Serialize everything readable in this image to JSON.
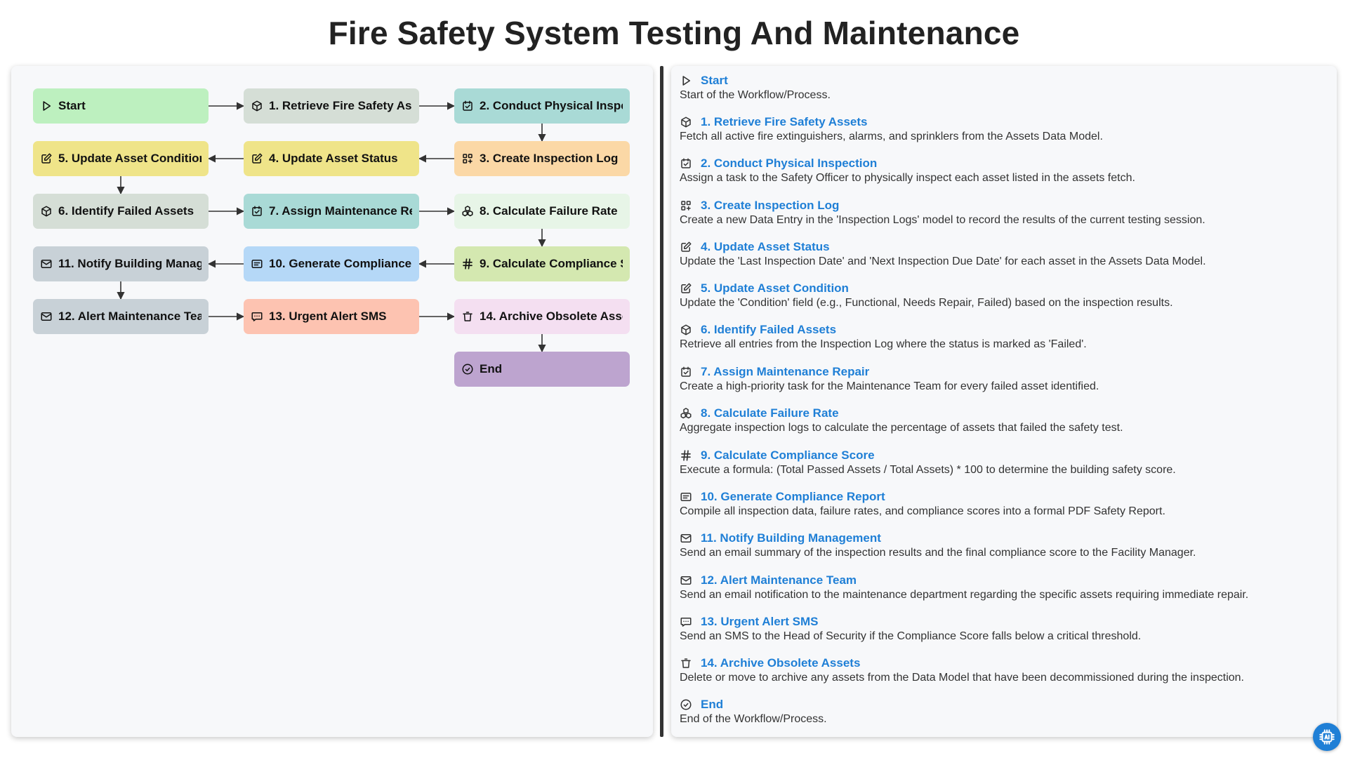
{
  "title": "Fire Safety System Testing And Maintenance",
  "colors": {
    "link": "#1f7fd6",
    "start": "#bdf0bf",
    "step1": "#d5ded6",
    "step2": "#a9dad6",
    "step3": "#fbd8a6",
    "step4": "#efe489",
    "step5": "#efe489",
    "step6": "#d5ded6",
    "step7": "#a9dad6",
    "step8": "#e7f5e7",
    "step9": "#d4e8b0",
    "step10": "#b5d8f7",
    "step11": "#c8d1d7",
    "step12": "#c8d1d7",
    "step13": "#fdc3b1",
    "step14": "#f4dff1",
    "end": "#bda4cf"
  },
  "nodes": [
    {
      "id": "start",
      "label": "Start",
      "icon": "play-icon",
      "title": "Start",
      "desc": "Start of the Workflow/Process."
    },
    {
      "id": "n1",
      "label": "1. Retrieve Fire Safety Assets",
      "icon": "cube-icon",
      "title": "1. Retrieve Fire Safety Assets",
      "desc": "Fetch all active fire extinguishers, alarms, and sprinklers from the Assets Data Model."
    },
    {
      "id": "n2",
      "label": "2. Conduct Physical Inspection",
      "icon": "checkbox-icon",
      "title": "2. Conduct Physical Inspection",
      "desc": "Assign a task to the Safety Officer to physically inspect each asset listed in the assets fetch."
    },
    {
      "id": "n3",
      "label": "3. Create Inspection Log",
      "icon": "grid-plus-icon",
      "title": "3. Create Inspection Log",
      "desc": "Create a new Data Entry in the 'Inspection Logs' model to record the results of the current testing session."
    },
    {
      "id": "n4",
      "label": "4. Update Asset Status",
      "icon": "edit-icon",
      "title": "4. Update Asset Status",
      "desc": "Update the 'Last Inspection Date' and 'Next Inspection Due Date' for each asset in the Assets Data Model."
    },
    {
      "id": "n5",
      "label": "5. Update Asset Condition",
      "icon": "edit-icon",
      "title": "5. Update Asset Condition",
      "desc": "Update the 'Condition' field (e.g., Functional, Needs Repair, Failed) based on the inspection results."
    },
    {
      "id": "n6",
      "label": "6. Identify Failed Assets",
      "icon": "cube-icon",
      "title": "6. Identify Failed Assets",
      "desc": "Retrieve all entries from the Inspection Log where the status is marked as 'Failed'."
    },
    {
      "id": "n7",
      "label": "7. Assign Maintenance Repair",
      "icon": "checkbox-icon",
      "title": "7. Assign Maintenance Repair",
      "desc": "Create a high-priority task for the Maintenance Team for every failed asset identified."
    },
    {
      "id": "n8",
      "label": "8. Calculate Failure Rate",
      "icon": "cubes-icon",
      "title": "8. Calculate Failure Rate",
      "desc": "Aggregate inspection logs to calculate the percentage of assets that failed the safety test."
    },
    {
      "id": "n9",
      "label": "9. Calculate Compliance Score",
      "icon": "hash-icon",
      "title": "9. Calculate Compliance Score",
      "desc": "Execute a formula: (Total Passed Assets / Total Assets) * 100 to determine the building safety score."
    },
    {
      "id": "n10",
      "label": "10. Generate Compliance Report",
      "icon": "report-icon",
      "title": "10. Generate Compliance Report",
      "desc": "Compile all inspection data, failure rates, and compliance scores into a formal PDF Safety Report."
    },
    {
      "id": "n11",
      "label": "11. Notify Building Management",
      "icon": "mail-icon",
      "title": "11. Notify Building Management",
      "desc": "Send an email summary of the inspection results and the final compliance score to the Facility Manager."
    },
    {
      "id": "n12",
      "label": "12. Alert Maintenance Team",
      "icon": "mail-icon",
      "title": "12. Alert Maintenance Team",
      "desc": "Send an email notification to the maintenance department regarding the specific assets requiring immediate repair."
    },
    {
      "id": "n13",
      "label": "13. Urgent Alert SMS",
      "icon": "sms-icon",
      "title": "13. Urgent Alert SMS",
      "desc": "Send an SMS to the Head of Security if the Compliance Score falls below a critical threshold."
    },
    {
      "id": "n14",
      "label": "14. Archive Obsolete Assets",
      "icon": "trash-icon",
      "title": "14. Archive Obsolete Assets",
      "desc": "Delete or move to archive any assets from the Data Model that have been decommissioned during the inspection."
    },
    {
      "id": "end",
      "label": "End",
      "icon": "check-circle-icon",
      "title": "End",
      "desc": "End of the Workflow/Process."
    }
  ]
}
